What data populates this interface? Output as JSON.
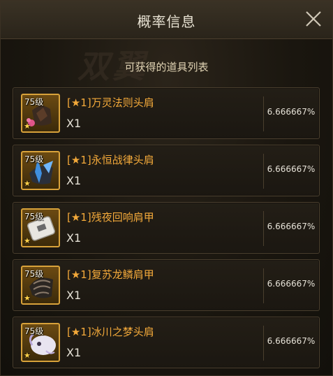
{
  "dialog": {
    "title": "概率信息",
    "subtitle": "可获得的道具列表",
    "background_text": "双翼"
  },
  "items": [
    {
      "level": "75级",
      "name": "[★1]万灵法则头肩",
      "quantity": "X1",
      "probability": "6.666667%",
      "icon": "shoulder-armor-dark-pink-icon"
    },
    {
      "level": "75级",
      "name": "[★1]永恒战律头肩",
      "quantity": "X1",
      "probability": "6.666667%",
      "icon": "shoulder-armor-blue-blade-icon"
    },
    {
      "level": "75级",
      "name": "[★1]残夜回响肩甲",
      "quantity": "X1",
      "probability": "6.666667%",
      "icon": "shoulder-armor-white-plate-icon"
    },
    {
      "level": "75级",
      "name": "[★1]复苏龙鳞肩甲",
      "quantity": "X1",
      "probability": "6.666667%",
      "icon": "shoulder-armor-dragon-scale-icon"
    },
    {
      "level": "75级",
      "name": "[★1]冰川之梦头肩",
      "quantity": "X1",
      "probability": "6.666667%",
      "icon": "shoulder-armor-white-spirit-icon"
    }
  ],
  "colors": {
    "item_name": "#f3a93a",
    "icon_frame": "#d8a23a",
    "text": "#e6e2d7"
  }
}
